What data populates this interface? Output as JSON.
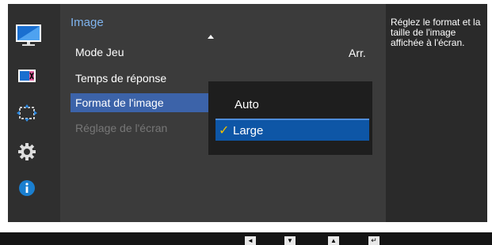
{
  "colors": {
    "frame": "#2a2a2a",
    "main_panel": "#3b3b3b",
    "selection": "#3c63a9",
    "option_selected": "#0e56a6",
    "title": "#7fb4ee",
    "check": "#f0c000",
    "info_blue": "#1a7fd0"
  },
  "sidebar": {
    "items": [
      {
        "icon": "image-monitor-icon",
        "selected": true
      },
      {
        "icon": "color-icon",
        "selected": false
      },
      {
        "icon": "size-position-icon",
        "selected": false
      },
      {
        "icon": "settings-gear-icon",
        "selected": false
      },
      {
        "icon": "info-icon",
        "selected": false
      }
    ]
  },
  "menu": {
    "title": "Image",
    "items": [
      {
        "label": "Mode Jeu",
        "value": "Arr."
      },
      {
        "label": "Temps de réponse"
      },
      {
        "label": "Format de l'image"
      },
      {
        "label": "Réglage de l'écran"
      }
    ]
  },
  "popup": {
    "options": [
      {
        "label": "Auto"
      },
      {
        "label": "Large",
        "check": "✓"
      }
    ]
  },
  "help": {
    "text": "Réglez le format et la taille de l'image affichée à l'écran."
  },
  "bottom_keys": [
    {
      "icon": "left-arrow-key-icon",
      "glyph": "◄"
    },
    {
      "icon": "down-arrow-key-icon",
      "glyph": "▼"
    },
    {
      "icon": "up-arrow-key-icon",
      "glyph": "▲"
    },
    {
      "icon": "enter-key-icon",
      "glyph": "↵"
    }
  ]
}
